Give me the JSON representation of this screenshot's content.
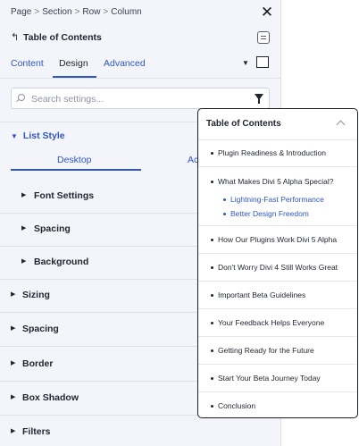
{
  "breadcrumb": [
    "Page",
    "Section",
    "Row",
    "Column"
  ],
  "breadcrumb_separator": ">",
  "module_title": "Table of Contents",
  "tabs": [
    {
      "label": "Content"
    },
    {
      "label": "Design",
      "active": true
    },
    {
      "label": "Advanced"
    }
  ],
  "search": {
    "placeholder": "Search settings...",
    "value": ""
  },
  "list_style": {
    "heading": "List Style",
    "expanded": true,
    "device_tabs": [
      {
        "label": "Desktop",
        "active": true
      },
      {
        "label": "Ac"
      }
    ],
    "subgroups": [
      "Font Settings",
      "Spacing",
      "Background"
    ]
  },
  "groups": [
    "Sizing",
    "Spacing",
    "Border",
    "Box Shadow",
    "Filters"
  ],
  "toc": {
    "title": "Table of Contents",
    "items": [
      "Plugin Readiness & Introduction",
      "What Makes Divi 5 Alpha Special?",
      "How Our Plugins Work Divi 5 Alpha",
      "Don't Worry Divi 4 Still Works Great",
      "Important Beta Guidelines",
      "Your Feedback Helps Everyone",
      "Getting Ready for the Future",
      "Start Your Beta Journey Today",
      "Conclusion"
    ],
    "subitems": [
      "Lightning-Fast Performance",
      "Better Design Freedom"
    ]
  },
  "colors": {
    "accent": "#2f56c6",
    "panel_bg": "#f4f5fa",
    "text": "#1f2430",
    "border": "#dfe1ea"
  }
}
